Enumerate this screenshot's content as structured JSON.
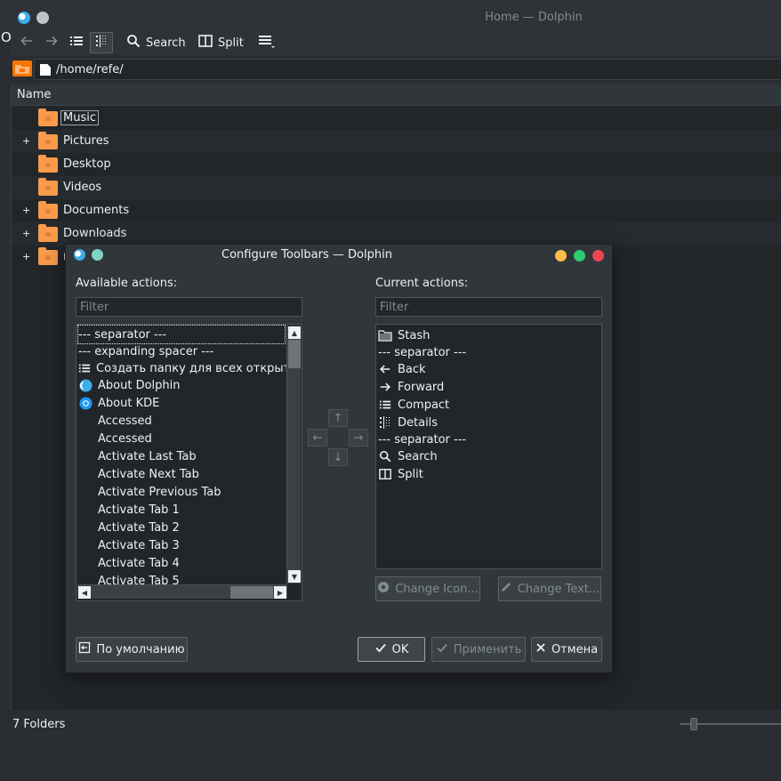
{
  "window": {
    "title": "Home — Dolphin",
    "edge_glyph": "O"
  },
  "toolbar": {
    "search_label": "Search",
    "split_label": "Split"
  },
  "location": {
    "path": "/home/refe/"
  },
  "view": {
    "column_header": "Name",
    "folders": [
      {
        "name": "Music",
        "expandable": false
      },
      {
        "name": "Pictures",
        "expandable": true
      },
      {
        "name": "Desktop",
        "expandable": false
      },
      {
        "name": "Videos",
        "expandable": false
      },
      {
        "name": "Documents",
        "expandable": true
      },
      {
        "name": "Downloads",
        "expandable": true
      },
      {
        "name": "n",
        "expandable": true
      }
    ]
  },
  "status": {
    "text": "7 Folders"
  },
  "dialog": {
    "title": "Configure Toolbars — Dolphin",
    "available_label": "Available actions:",
    "current_label": "Current actions:",
    "filter_placeholder": "Filter",
    "available_actions": [
      {
        "label": "--- separator ---",
        "icon": ""
      },
      {
        "label": "--- expanding spacer ---",
        "icon": ""
      },
      {
        "label": "Создать папку для всех открытых",
        "icon": "list-icon"
      },
      {
        "label": "About Dolphin",
        "icon": "dolphin-icon"
      },
      {
        "label": "About KDE",
        "icon": "kde-icon"
      },
      {
        "label": "Accessed",
        "icon": ""
      },
      {
        "label": "Accessed",
        "icon": ""
      },
      {
        "label": "Activate Last Tab",
        "icon": ""
      },
      {
        "label": "Activate Next Tab",
        "icon": ""
      },
      {
        "label": "Activate Previous Tab",
        "icon": ""
      },
      {
        "label": "Activate Tab 1",
        "icon": ""
      },
      {
        "label": "Activate Tab 2",
        "icon": ""
      },
      {
        "label": "Activate Tab 3",
        "icon": ""
      },
      {
        "label": "Activate Tab 4",
        "icon": ""
      },
      {
        "label": "Activate Tab 5",
        "icon": ""
      }
    ],
    "current_actions": [
      {
        "label": "Stash",
        "icon": "folder-icon"
      },
      {
        "label": "--- separator ---",
        "icon": ""
      },
      {
        "label": "Back",
        "icon": "arrow-left-icon"
      },
      {
        "label": "Forward",
        "icon": "arrow-right-icon"
      },
      {
        "label": "Compact",
        "icon": "list-icon"
      },
      {
        "label": "Details",
        "icon": "details-icon"
      },
      {
        "label": "--- separator ---",
        "icon": ""
      },
      {
        "label": "Search",
        "icon": "search-icon"
      },
      {
        "label": "Split",
        "icon": "split-icon"
      }
    ],
    "change_icon_label": "Change Icon...",
    "change_text_label": "Change Text...",
    "defaults_label": "По умолчанию",
    "ok_label": "OK",
    "apply_label": "Применить",
    "cancel_label": "Отмена"
  }
}
